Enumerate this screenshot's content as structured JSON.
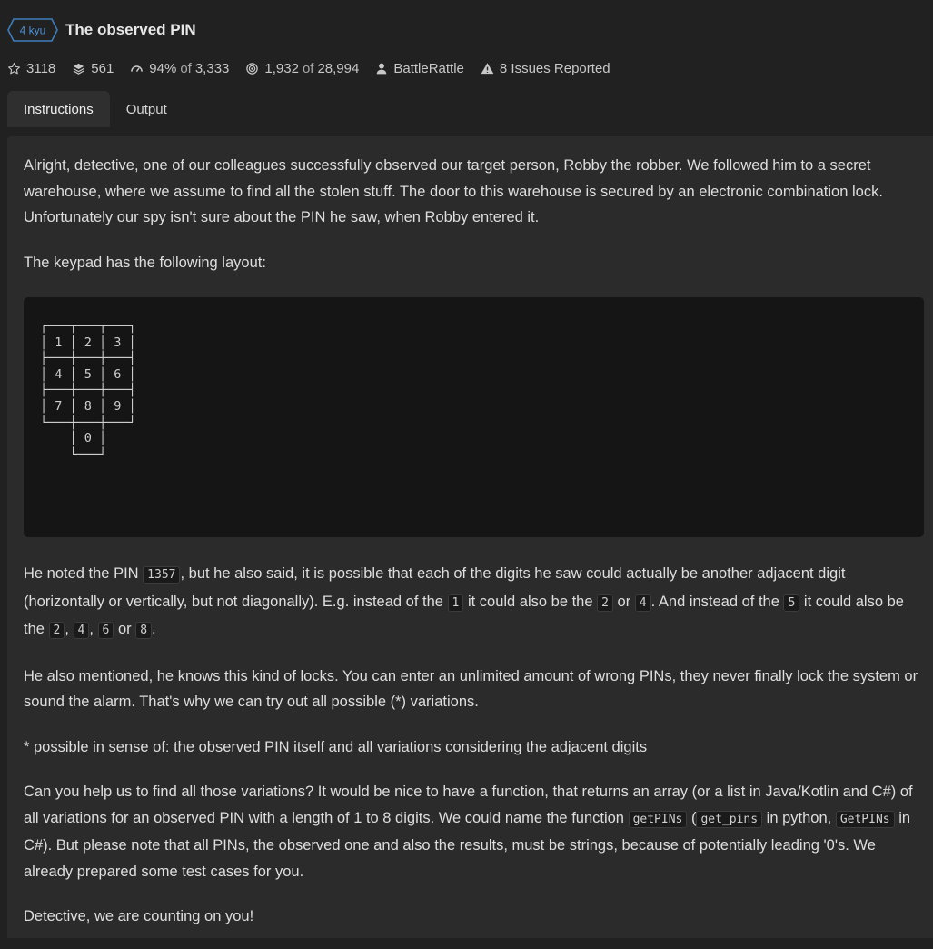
{
  "kata": {
    "rank": "4 kyu",
    "title": "The observed PIN",
    "accent_color": "#3c7ebb"
  },
  "stats": {
    "stars": "3118",
    "collections": "561",
    "satisfaction": "94%",
    "satisfaction_of": "of",
    "satisfaction_votes": "3,333",
    "completed": "1,932",
    "completed_of": "of",
    "completed_total": "28,994",
    "author": "BattleRattle",
    "issues": "8 Issues Reported"
  },
  "icons": {
    "stars": "star-outline-icon",
    "collections": "layers-icon",
    "satisfaction": "gauge-icon",
    "completed": "target-icon",
    "author": "user-icon",
    "issues": "warning-icon"
  },
  "tabs": [
    "Instructions",
    "Output"
  ],
  "description": {
    "p1": "Alright, detective, one of our colleagues successfully observed our target person, Robby the robber. We followed him to a secret warehouse, where we assume to find all the stolen stuff. The door to this warehouse is secured by an electronic combination lock. Unfortunately our spy isn't sure about the PIN he saw, when Robby entered it.",
    "p2": "The keypad has the following layout:",
    "keypad": "┌───┬───┬───┐\n│ 1 │ 2 │ 3 │\n├───┼───┼───┤\n│ 4 │ 5 │ 6 │\n├───┼───┼───┤\n│ 7 │ 8 │ 9 │\n└───┼───┼───┘\n    │ 0 │\n    └───┘",
    "p3": {
      "a": "He noted the PIN ",
      "code1": "1357",
      "b": ", but he also said, it is possible that each of the digits he saw could actually be another adjacent digit (horizontally or vertically, but not diagonally). E.g. instead of the ",
      "code2": "1",
      "c": " it could also be the ",
      "code3": "2",
      "d": " or ",
      "code4": "4",
      "e": ". And instead of the ",
      "code5": "5",
      "f": " it could also be the ",
      "code6": "2",
      "g": ", ",
      "code7": "4",
      "h": ", ",
      "code8": "6",
      "i": " or ",
      "code9": "8",
      "j": "."
    },
    "p4": "He also mentioned, he knows this kind of locks. You can enter an unlimited amount of wrong PINs, they never finally lock the system or sound the alarm. That's why we can try out all possible (*) variations.",
    "p5": "* possible in sense of: the observed PIN itself and all variations considering the adjacent digits",
    "p6": {
      "a": "Can you help us to find all those variations? It would be nice to have a function, that returns an array (or a list in Java/Kotlin and C#) of all variations for an observed PIN with a length of 1 to 8 digits. We could name the function ",
      "code1": "getPINs",
      "b": " (",
      "code2": "get_pins",
      "c": " in python, ",
      "code3": "GetPINs",
      "d": " in C#). But please note that all PINs, the observed one and also the results, must be strings, because of potentially leading '0's. We already prepared some test cases for you."
    },
    "p7": "Detective, we are counting on you!"
  }
}
